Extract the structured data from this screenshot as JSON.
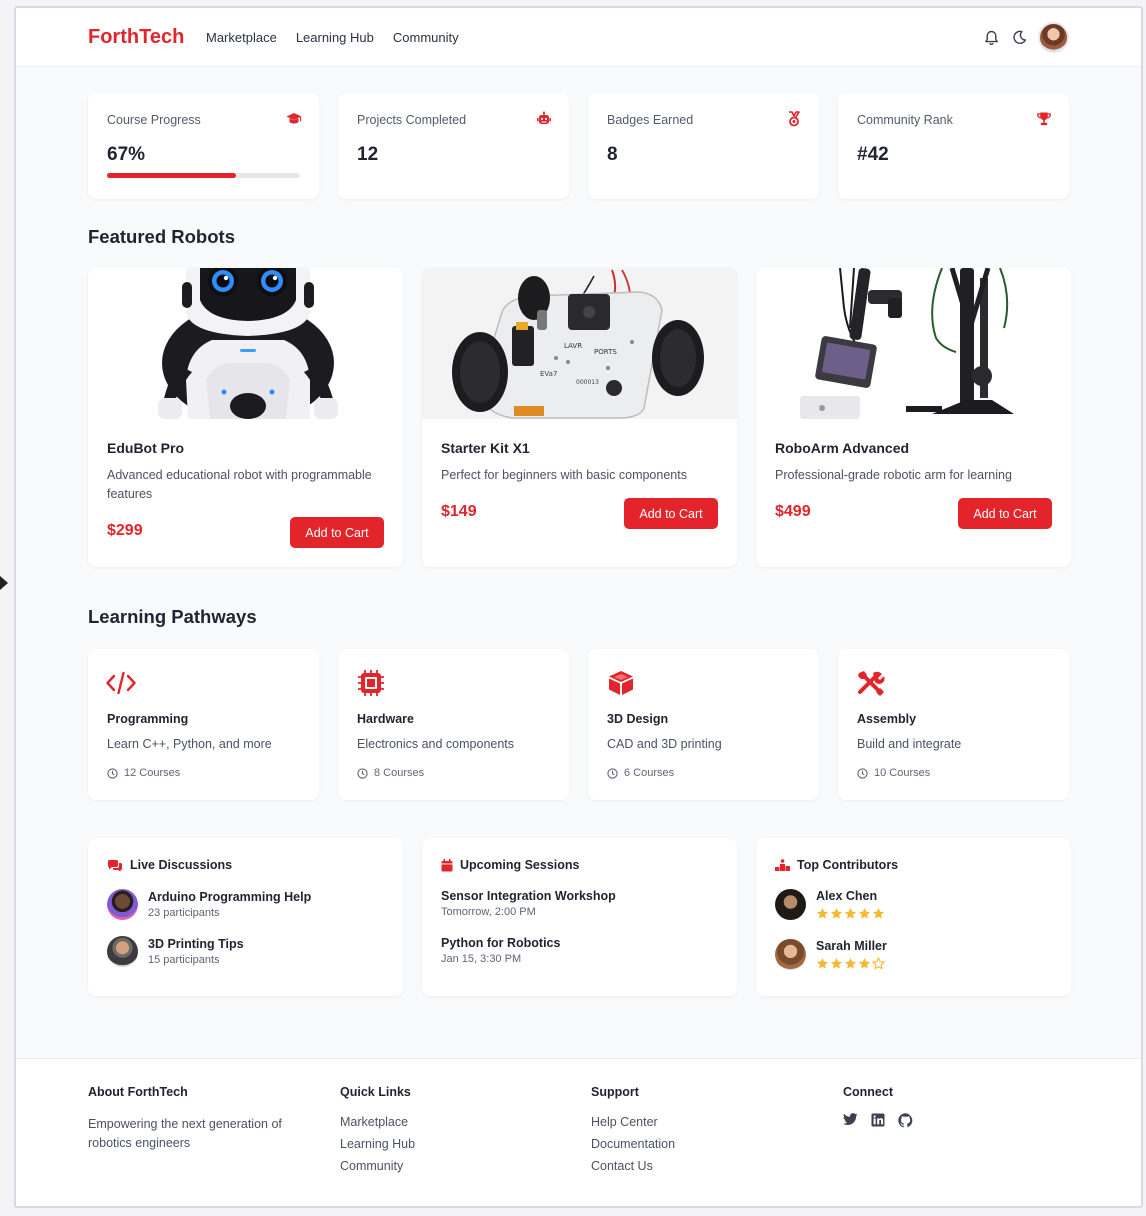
{
  "brand": "ForthTech",
  "nav": [
    "Marketplace",
    "Learning Hub",
    "Community"
  ],
  "header_icons": [
    "bell-icon",
    "moon-icon",
    "user-avatar"
  ],
  "stats": [
    {
      "label": "Course Progress",
      "value": "67%",
      "icon": "graduation-cap-icon",
      "progress": 0.67
    },
    {
      "label": "Projects Completed",
      "value": "12",
      "icon": "robot-icon"
    },
    {
      "label": "Badges Earned",
      "value": "8",
      "icon": "medal-icon"
    },
    {
      "label": "Community Rank",
      "value": "#42",
      "icon": "trophy-icon"
    }
  ],
  "featured_title": "Featured Robots",
  "robots": [
    {
      "name": "EduBot Pro",
      "desc": "Advanced educational robot with programmable features",
      "price": "$299",
      "cta": "Add to Cart"
    },
    {
      "name": "Starter Kit X1",
      "desc": "Perfect for beginners with basic components",
      "price": "$149",
      "cta": "Add to Cart"
    },
    {
      "name": "RoboArm Advanced",
      "desc": "Professional-grade robotic arm for learning",
      "price": "$499",
      "cta": "Add to Cart"
    }
  ],
  "pathways_title": "Learning Pathways",
  "pathways": [
    {
      "title": "Programming",
      "desc": "Learn C++, Python, and more",
      "meta": "12 Courses",
      "icon": "code-icon"
    },
    {
      "title": "Hardware",
      "desc": "Electronics and components",
      "meta": "8 Courses",
      "icon": "microchip-icon"
    },
    {
      "title": "3D Design",
      "desc": "CAD and 3D printing",
      "meta": "6 Courses",
      "icon": "cube-icon"
    },
    {
      "title": "Assembly",
      "desc": "Build and integrate",
      "meta": "10 Courses",
      "icon": "tools-icon"
    }
  ],
  "discussions": {
    "title": "Live Discussions",
    "items": [
      {
        "title": "Arduino Programming Help",
        "sub": "23 participants"
      },
      {
        "title": "3D Printing Tips",
        "sub": "15 participants"
      }
    ]
  },
  "sessions": {
    "title": "Upcoming Sessions",
    "items": [
      {
        "title": "Sensor Integration Workshop",
        "sub": "Tomorrow, 2:00 PM"
      },
      {
        "title": "Python for Robotics",
        "sub": "Jan 15, 3:30 PM"
      }
    ]
  },
  "contributors": {
    "title": "Top Contributors",
    "items": [
      {
        "name": "Alex Chen",
        "rating": 5
      },
      {
        "name": "Sarah Miller",
        "rating": 4
      }
    ]
  },
  "footer": {
    "about_title": "About ForthTech",
    "about_text": "Empowering the next generation of robotics engineers",
    "links_title": "Quick Links",
    "links": [
      "Marketplace",
      "Learning Hub",
      "Community"
    ],
    "support_title": "Support",
    "support": [
      "Help Center",
      "Documentation",
      "Contact Us"
    ],
    "connect_title": "Connect",
    "social": [
      "twitter-icon",
      "linkedin-icon",
      "github-icon"
    ]
  },
  "colors": {
    "accent": "#e3242b",
    "star": "#f5b82e",
    "background": "#f9fafb"
  }
}
